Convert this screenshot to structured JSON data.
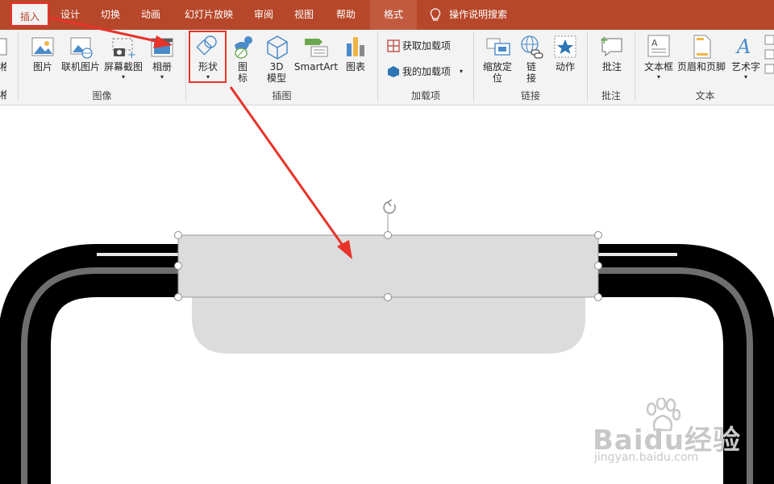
{
  "tabs": [
    {
      "label": "插入"
    },
    {
      "label": "设计"
    },
    {
      "label": "切换"
    },
    {
      "label": "动画"
    },
    {
      "label": "幻灯片放映"
    },
    {
      "label": "审阅"
    },
    {
      "label": "视图"
    },
    {
      "label": "帮助"
    },
    {
      "label": "格式"
    }
  ],
  "search": {
    "label": "操作说明搜索"
  },
  "ribbon": {
    "cut_left": {
      "top": "格",
      "bottom": "格"
    },
    "images": {
      "picture": "图片",
      "online_picture": "联机图片",
      "screenshot": "屏幕截图",
      "album": "相册",
      "group": "图像"
    },
    "illustrations": {
      "shape": "形状",
      "icon_l1": "图",
      "icon_l2": "标",
      "model_l1": "3D",
      "model_l2": "模型",
      "smartart": "SmartArt",
      "chart": "图表",
      "group": "插图"
    },
    "addins": {
      "get": "获取加载项",
      "mine": "我的加载项",
      "group": "加载项"
    },
    "links": {
      "zoom_l1": "缩放定",
      "zoom_l2": "位",
      "link_l1": "链",
      "link_l2": "接",
      "action": "动作",
      "group": "链接"
    },
    "comments": {
      "comment": "批注",
      "group": "批注"
    },
    "text": {
      "textbox": "文本框",
      "header_footer": "页眉和页脚",
      "wordart": "艺术字",
      "group": "文本"
    }
  },
  "watermark": {
    "brand": "Baidu经验",
    "url": "jingyan.baidu.com"
  },
  "colors": {
    "accent": "#b7472a",
    "highlight": "#e8332a",
    "shape_fill": "#dcdcdc"
  }
}
